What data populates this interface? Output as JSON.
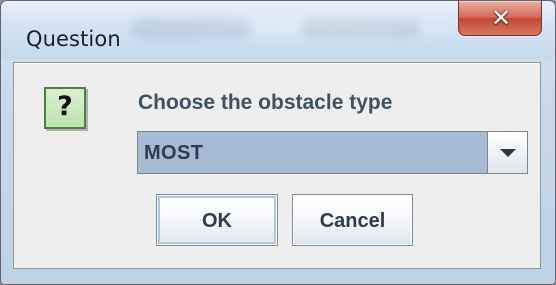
{
  "window": {
    "title": "Question",
    "close_symbol": "✕"
  },
  "dialog": {
    "icon_symbol": "?",
    "prompt": "Choose the obstacle type",
    "selected_option": "MOST"
  },
  "buttons": {
    "ok": "OK",
    "cancel": "Cancel"
  },
  "icons": {
    "question": "question-icon",
    "dropdown": "chevron-down-icon",
    "close": "close-icon"
  },
  "colors": {
    "title_bar": "#D4E4F4",
    "close_button": "#C54634",
    "dialog_background": "#EEEEEE",
    "prompt_text": "#3F5163",
    "selected_background": "#A6BBD3",
    "question_icon": "#BDE3AE"
  }
}
